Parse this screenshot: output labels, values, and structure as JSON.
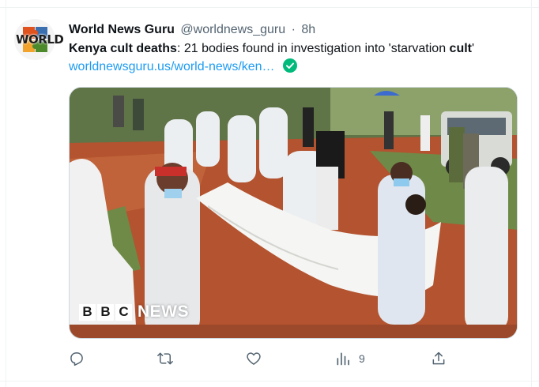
{
  "tweet": {
    "author": {
      "display_name": "World News Guru",
      "handle": "@worldnews_guru",
      "avatar_text": "WORLD",
      "avatar_icon": "puzzle-logo-icon"
    },
    "separator": "·",
    "time": "8h",
    "text": {
      "bold_lead": "Kenya cult deaths",
      "segment_1": ": 21 bodies found in investigation into 'starvation ",
      "bold_word": "cult",
      "segment_2": "'"
    },
    "link": {
      "text": "worldnewsguru.us/world-news/ken…",
      "badge_icon": "green-check-icon"
    },
    "media": {
      "type": "photo",
      "watermark_blocks": [
        "B",
        "B",
        "C"
      ],
      "watermark_text": "NEWS"
    },
    "actions": {
      "reply_icon": "reply-icon",
      "retweet_icon": "retweet-icon",
      "like_icon": "heart-icon",
      "views_icon": "views-chart-icon",
      "views_count": "9",
      "share_icon": "share-icon"
    }
  },
  "colors": {
    "text_primary": "#0f1419",
    "text_secondary": "#536471",
    "link": "#1d9bf0",
    "check_badge": "#00ba7c",
    "border": "#cfd9de"
  }
}
